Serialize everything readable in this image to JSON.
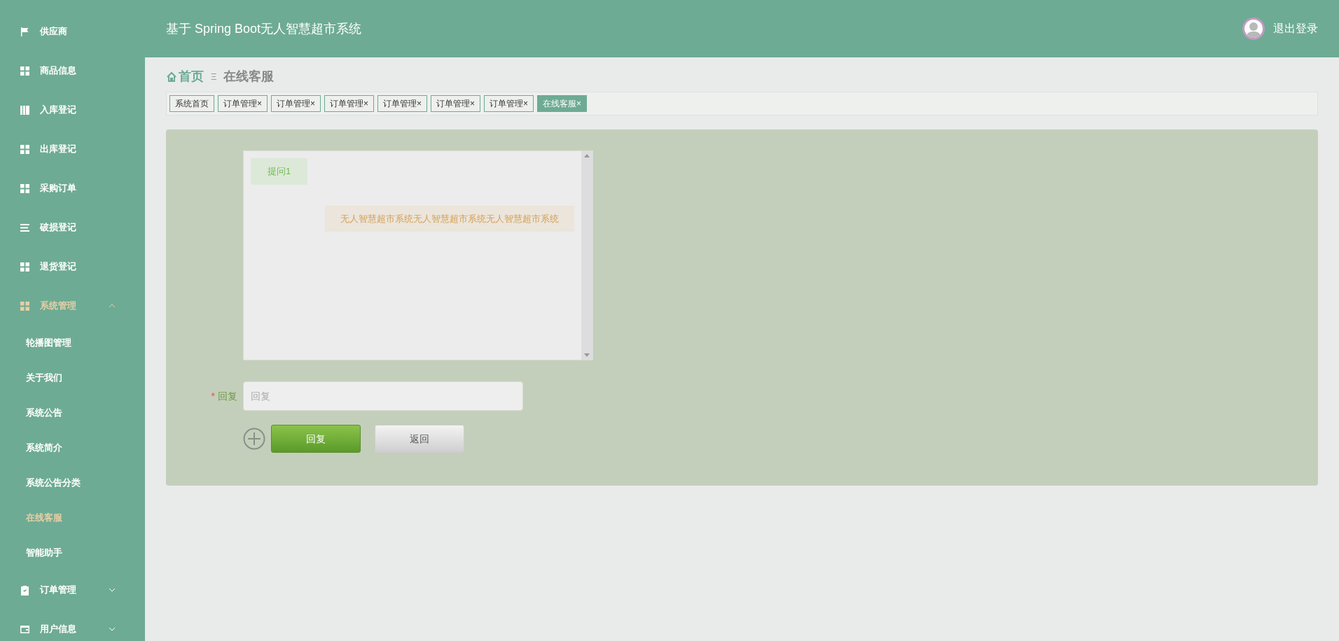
{
  "header": {
    "title": "基于 Spring Boot无人智慧超市系统",
    "logout": "退出登录"
  },
  "sidebar": {
    "items": [
      {
        "label": "供应商",
        "kind": "link",
        "selected": false
      },
      {
        "label": "商品信息",
        "kind": "link",
        "selected": false
      },
      {
        "label": "入库登记",
        "kind": "link",
        "selected": false
      },
      {
        "label": "出库登记",
        "kind": "link",
        "selected": false
      },
      {
        "label": "采购订单",
        "kind": "link",
        "selected": false
      },
      {
        "label": "破损登记",
        "kind": "link",
        "selected": false
      },
      {
        "label": "退货登记",
        "kind": "link",
        "selected": false
      },
      {
        "label": "系统管理",
        "kind": "group",
        "expanded": true,
        "selected": true,
        "children": [
          {
            "label": "轮播图管理",
            "selected": false
          },
          {
            "label": "关于我们",
            "selected": false
          },
          {
            "label": "系统公告",
            "selected": false
          },
          {
            "label": "系统简介",
            "selected": false
          },
          {
            "label": "系统公告分类",
            "selected": false
          },
          {
            "label": "在线客服",
            "selected": true
          },
          {
            "label": "智能助手",
            "selected": false
          }
        ]
      },
      {
        "label": "订单管理",
        "kind": "group",
        "expanded": false,
        "selected": false
      },
      {
        "label": "用户信息",
        "kind": "group",
        "expanded": false,
        "selected": false
      }
    ]
  },
  "breadcrumb": {
    "home": "首页",
    "separator": "Ξ",
    "current": "在线客服"
  },
  "tabs": [
    {
      "label": "系统首页",
      "selected": false
    },
    {
      "label": "订单管理",
      "close": "×",
      "selected": false
    },
    {
      "label": "订单管理",
      "close": "×",
      "selected": false
    },
    {
      "label": "订单管理",
      "close": "×",
      "selected": false
    },
    {
      "label": "订单管理",
      "close": "×",
      "selected": false
    },
    {
      "label": "订单管理",
      "close": "×",
      "selected": false
    },
    {
      "label": "订单管理",
      "close": "×",
      "selected": false
    },
    {
      "label": "在线客服",
      "close": "×",
      "selected": true
    }
  ],
  "chat": {
    "messages": [
      {
        "kind": "question",
        "text": "提问1"
      },
      {
        "kind": "answer",
        "text": "无人智慧超市系统无人智慧超市系统无人智慧超市系统"
      }
    ]
  },
  "reply_form": {
    "required_mark": "*",
    "label": "回复",
    "placeholder": "回复"
  },
  "buttons": [
    {
      "kind": "primary",
      "label": "回复"
    },
    {
      "kind": "secondary",
      "label": "返回"
    }
  ]
}
